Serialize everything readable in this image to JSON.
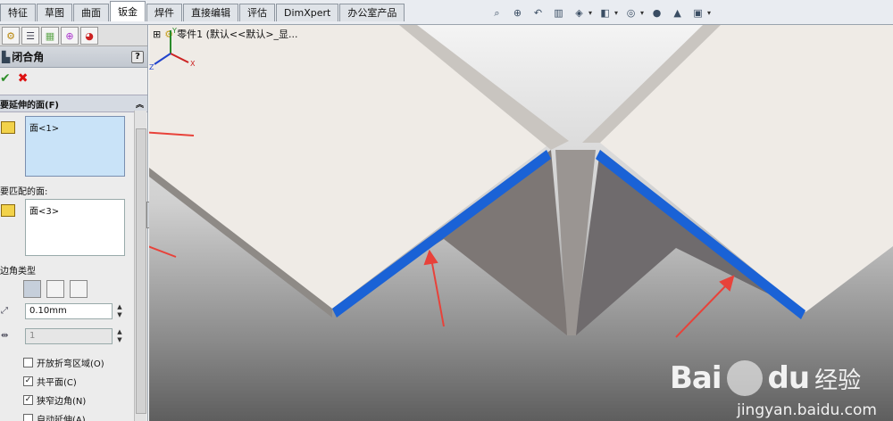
{
  "tabs": [
    "特征",
    "草图",
    "曲面",
    "钣金",
    "焊件",
    "直接编辑",
    "评估",
    "DimXpert",
    "办公室产品"
  ],
  "active_tab": 3,
  "toolbar_icons": [
    "zoom-to-fit-icon",
    "zoom-area-icon",
    "previous-view-icon",
    "section-view-icon",
    "view-orientation-icon",
    "display-style-icon",
    "hide-show-icon",
    "edit-appearance-icon",
    "apply-scene-icon",
    "view-settings-icon"
  ],
  "feature_tree": {
    "expander": "⊞",
    "label": "零件1  (默认<<默认>_显..."
  },
  "property_manager": {
    "title": "闭合角",
    "help": "?",
    "ok_label": "✔",
    "cancel_label": "✖",
    "group_title": "要延伸的面(F)",
    "collapse": "︽",
    "faces_to_extend": "面<1>",
    "faces_to_match_label": "要匹配的面:",
    "faces_to_match": "面<3>",
    "corner_type_label": "边角类型",
    "gap_value": "0.10mm",
    "overlap_value": "1",
    "options": [
      {
        "label": "开放折弯区域(O)",
        "checked": false
      },
      {
        "label": "共平面(C)",
        "checked": true
      },
      {
        "label": "狭窄边角(N)",
        "checked": true
      },
      {
        "label": "自动延伸(A)",
        "checked": false
      }
    ]
  },
  "triad": {
    "x": "X",
    "y": "Y",
    "z": "Z"
  },
  "watermark": {
    "brand": "Bai",
    "brand2": "du",
    "cn": "经验",
    "url": "jingyan.baidu.com"
  },
  "colors": {
    "highlight_edge": "#1a62d6",
    "arrow": "#e8423a",
    "sheet": "#efebe6"
  }
}
